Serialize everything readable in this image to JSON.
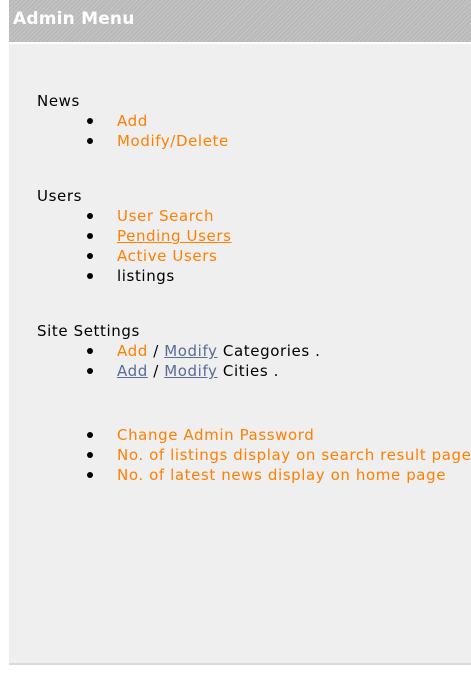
{
  "header": {
    "title": "Admin Menu"
  },
  "news": {
    "title": "News",
    "add": "Add",
    "modify_delete": "Modify/Delete"
  },
  "users": {
    "title": "Users",
    "user_search": "User Search",
    "pending_users": "Pending Users",
    "active_users": "Active Users",
    "listings": "listings"
  },
  "site_settings": {
    "title": "Site Settings",
    "categories": {
      "add": "Add",
      "separator": " / ",
      "modify": "Modify",
      "label": " Categories ."
    },
    "cities": {
      "add": "Add",
      "separator": " / ",
      "modify": "Modify",
      "label": " Cities ."
    }
  },
  "other": {
    "change_password": "Change Admin Password",
    "listings_per_page": "No. of listings display on search result page",
    "latest_news": "No. of latest news display on home page"
  },
  "colors": {
    "link_orange": "#ff7f00",
    "link_blue": "#5a6b97",
    "panel_bg": "#efefef",
    "header_bg": "#b9b9b9"
  }
}
